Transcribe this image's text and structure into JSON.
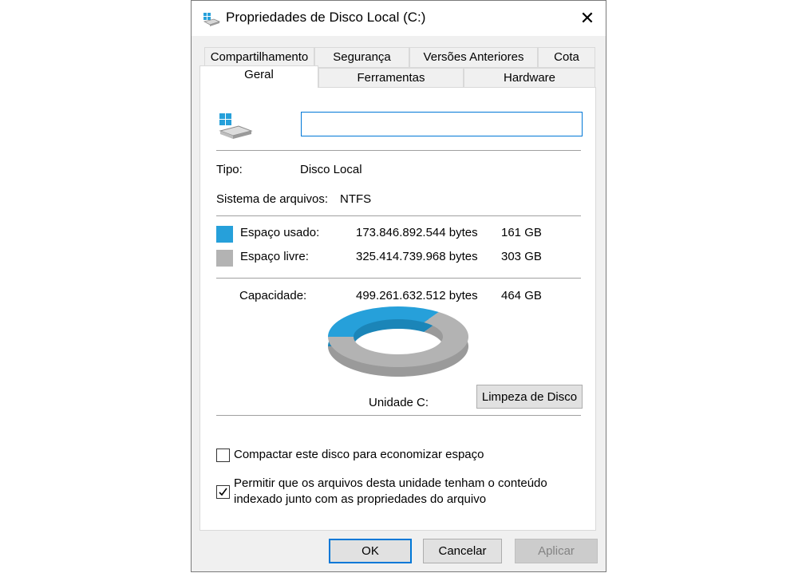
{
  "window": {
    "title": "Propriedades de Disco Local (C:)",
    "close_glyph": "✕"
  },
  "tabs_row1": [
    "Compartilhamento",
    "Segurança",
    "Versões Anteriores",
    "Cota"
  ],
  "tabs_row2": [
    "Geral",
    "Ferramentas",
    "Hardware"
  ],
  "active_tab": "Geral",
  "general": {
    "drive_name_value": "",
    "type_label": "Tipo:",
    "type_value": "Disco Local",
    "fs_label": "Sistema de arquivos:",
    "fs_value": "NTFS",
    "used_label": "Espaço usado:",
    "used_bytes": "173.846.892.544 bytes",
    "used_gb": "161 GB",
    "free_label": "Espaço livre:",
    "free_bytes": "325.414.739.968 bytes",
    "free_gb": "303 GB",
    "capacity_label": "Capacidade:",
    "capacity_bytes": "499.261.632.512 bytes",
    "capacity_gb": "464 GB",
    "drive_label": "Unidade C:",
    "cleanup_button": "Limpeza de Disco",
    "used_fraction": 0.348,
    "compress_label": "Compactar este disco para economizar espaço",
    "compress_checked": false,
    "index_label_line1": "Permitir que os arquivos desta unidade tenham o conteúdo",
    "index_label_line2": "indexado junto com as propriedades do arquivo",
    "index_checked": true
  },
  "buttons": {
    "ok": "OK",
    "cancel": "Cancelar",
    "apply": "Aplicar"
  },
  "colors": {
    "used": "#26a0da",
    "free": "#b3b3b3",
    "accent": "#0078d7"
  },
  "icons": [
    "drive-icon",
    "close-icon",
    "checkmark-icon"
  ]
}
